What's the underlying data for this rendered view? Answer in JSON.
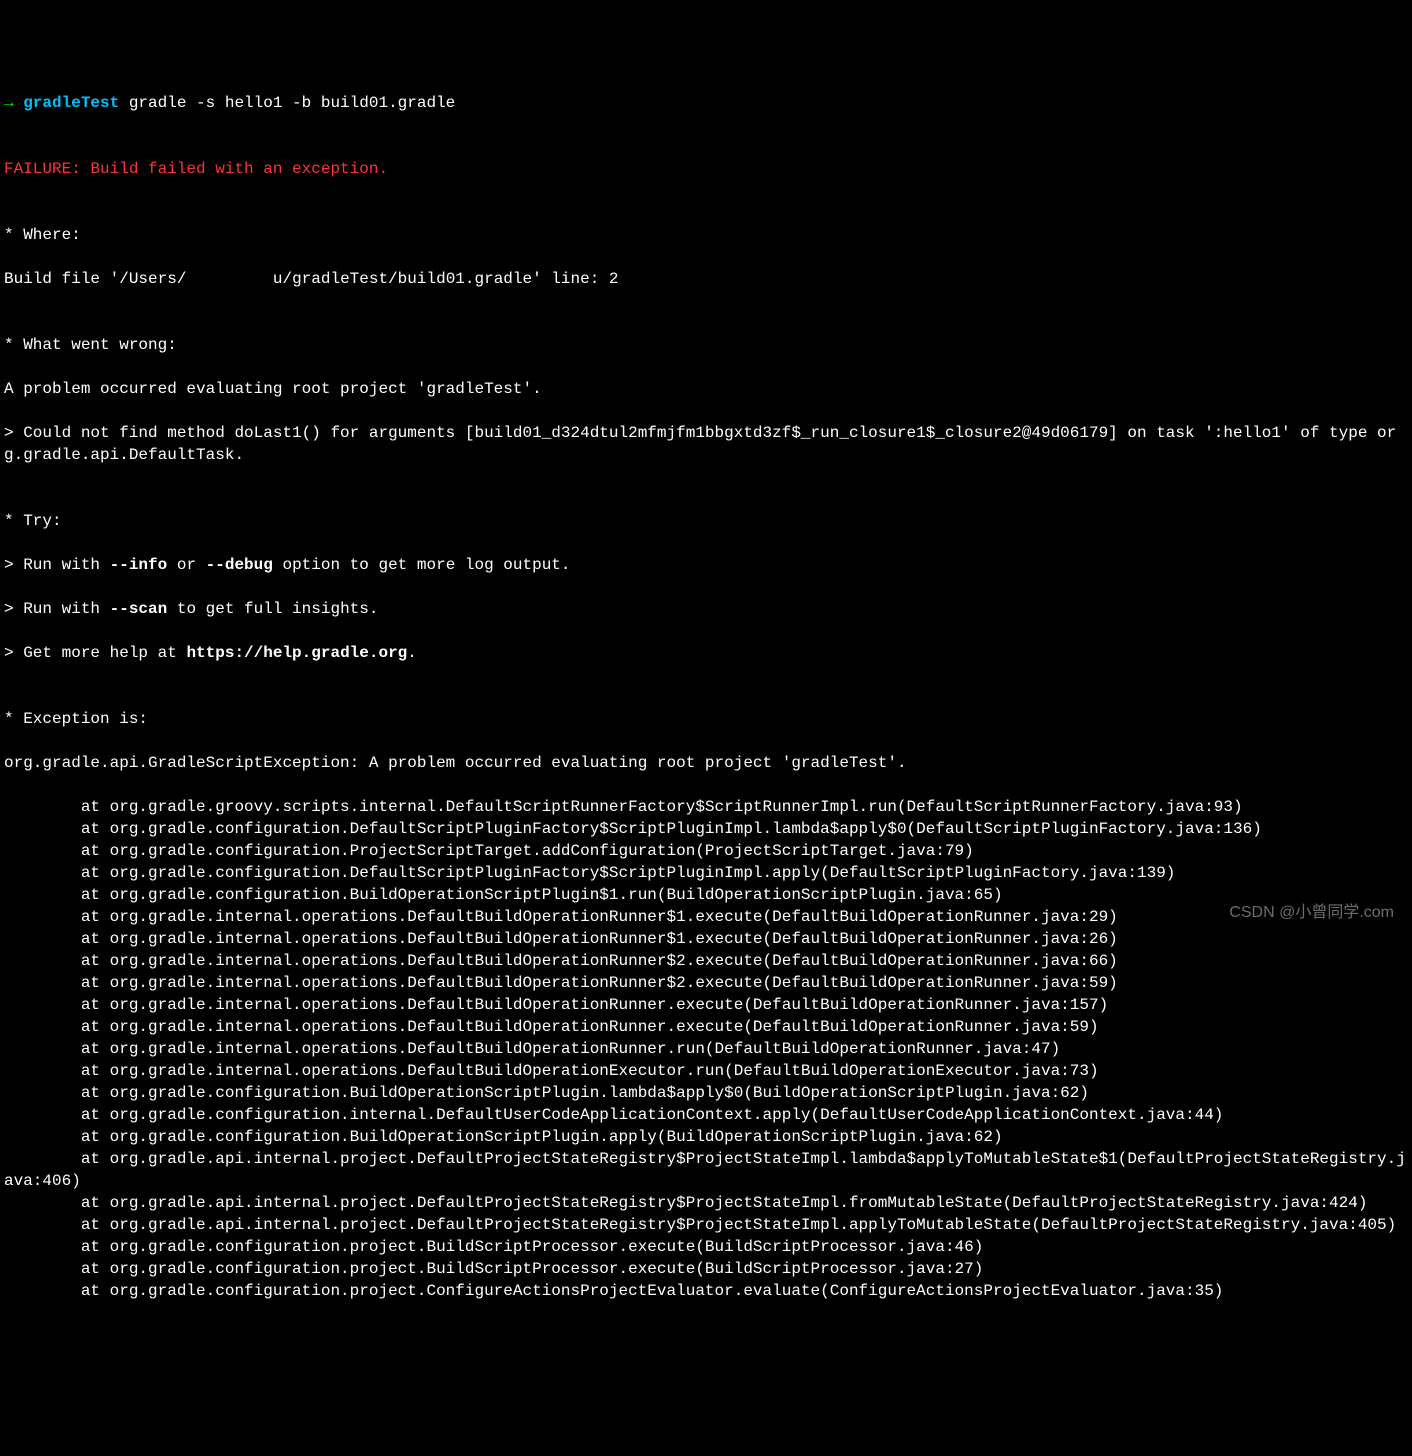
{
  "prompt": {
    "arrow": "→ ",
    "dir": "gradleTest",
    "command": " gradle -s hello1 -b build01.gradle"
  },
  "blank": "",
  "failure": "FAILURE: Build failed with an exception.",
  "where_header": "* Where:",
  "where_prefix": "Build file '/Users/",
  "where_suffix": "u/gradleTest/build01.gradle' line: 2",
  "wrong_header": "* What went wrong:",
  "wrong_line1": "A problem occurred evaluating root project 'gradleTest'.",
  "wrong_line2": "> Could not find method doLast1() for arguments [build01_d324dtul2mfmjfm1bbgxtd3zf$_run_closure1$_closure2@49d06179] on task ':hello1' of type org.gradle.api.DefaultTask.",
  "try_header": "* Try:",
  "try1_pre": "> Run with ",
  "try1_info": "--info",
  "try1_mid": " or ",
  "try1_debug": "--debug",
  "try1_post": " option to get more log output.",
  "try2_pre": "> Run with ",
  "try2_scan": "--scan",
  "try2_post": " to get full insights.",
  "try3_pre": "> Get more help at ",
  "try3_url": "https://help.gradle.org",
  "try3_post": ".",
  "exception_header": "* Exception is:",
  "exception_line": "org.gradle.api.GradleScriptException: A problem occurred evaluating root project 'gradleTest'.",
  "stack": [
    "        at org.gradle.groovy.scripts.internal.DefaultScriptRunnerFactory$ScriptRunnerImpl.run(DefaultScriptRunnerFactory.java:93)",
    "        at org.gradle.configuration.DefaultScriptPluginFactory$ScriptPluginImpl.lambda$apply$0(DefaultScriptPluginFactory.java:136)",
    "        at org.gradle.configuration.ProjectScriptTarget.addConfiguration(ProjectScriptTarget.java:79)",
    "        at org.gradle.configuration.DefaultScriptPluginFactory$ScriptPluginImpl.apply(DefaultScriptPluginFactory.java:139)",
    "        at org.gradle.configuration.BuildOperationScriptPlugin$1.run(BuildOperationScriptPlugin.java:65)",
    "        at org.gradle.internal.operations.DefaultBuildOperationRunner$1.execute(DefaultBuildOperationRunner.java:29)",
    "        at org.gradle.internal.operations.DefaultBuildOperationRunner$1.execute(DefaultBuildOperationRunner.java:26)",
    "        at org.gradle.internal.operations.DefaultBuildOperationRunner$2.execute(DefaultBuildOperationRunner.java:66)",
    "        at org.gradle.internal.operations.DefaultBuildOperationRunner$2.execute(DefaultBuildOperationRunner.java:59)",
    "        at org.gradle.internal.operations.DefaultBuildOperationRunner.execute(DefaultBuildOperationRunner.java:157)",
    "        at org.gradle.internal.operations.DefaultBuildOperationRunner.execute(DefaultBuildOperationRunner.java:59)",
    "        at org.gradle.internal.operations.DefaultBuildOperationRunner.run(DefaultBuildOperationRunner.java:47)",
    "        at org.gradle.internal.operations.DefaultBuildOperationExecutor.run(DefaultBuildOperationExecutor.java:73)",
    "        at org.gradle.configuration.BuildOperationScriptPlugin.lambda$apply$0(BuildOperationScriptPlugin.java:62)",
    "        at org.gradle.configuration.internal.DefaultUserCodeApplicationContext.apply(DefaultUserCodeApplicationContext.java:44)",
    "        at org.gradle.configuration.BuildOperationScriptPlugin.apply(BuildOperationScriptPlugin.java:62)",
    "        at org.gradle.api.internal.project.DefaultProjectStateRegistry$ProjectStateImpl.lambda$applyToMutableState$1(DefaultProjectStateRegistry.java:406)",
    "        at org.gradle.api.internal.project.DefaultProjectStateRegistry$ProjectStateImpl.fromMutableState(DefaultProjectStateRegistry.java:424)",
    "        at org.gradle.api.internal.project.DefaultProjectStateRegistry$ProjectStateImpl.applyToMutableState(DefaultProjectStateRegistry.java:405)",
    "        at org.gradle.configuration.project.BuildScriptProcessor.execute(BuildScriptProcessor.java:46)",
    "        at org.gradle.configuration.project.BuildScriptProcessor.execute(BuildScriptProcessor.java:27)",
    "        at org.gradle.configuration.project.ConfigureActionsProjectEvaluator.evaluate(ConfigureActionsProjectEvaluator.java:35)"
  ],
  "watermark": "CSDN @小曾同学.com"
}
